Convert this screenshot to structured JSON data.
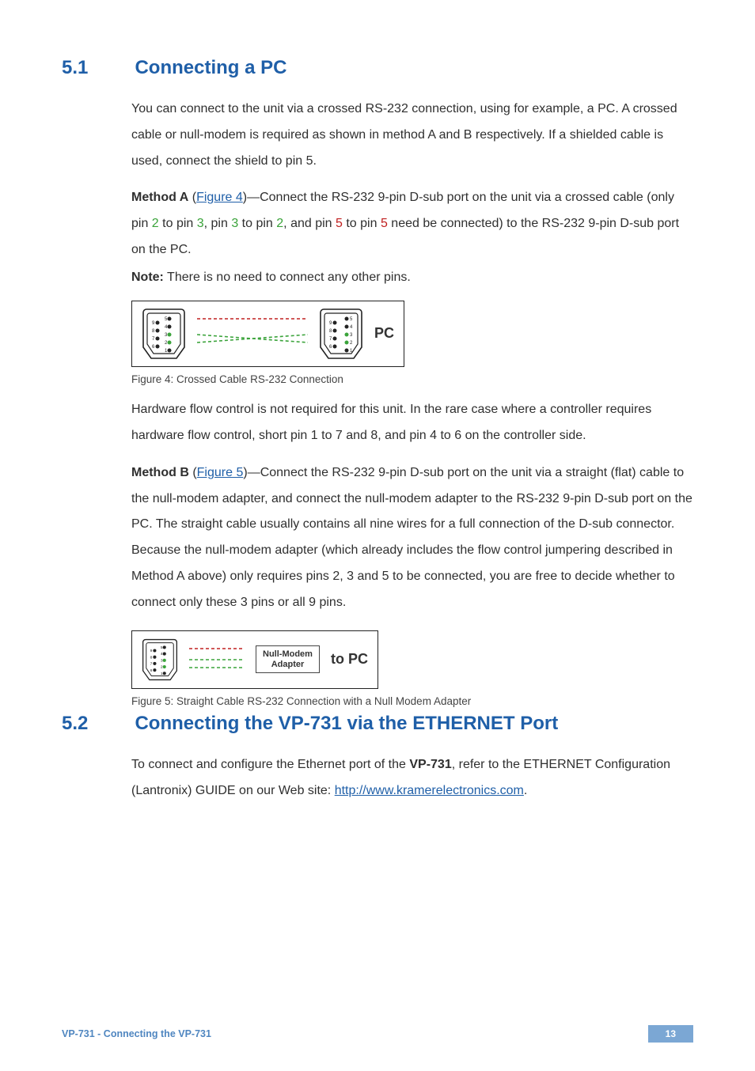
{
  "section1": {
    "num": "5.1",
    "title": "Connecting a PC",
    "p1": "You can connect to the unit via a crossed RS-232 connection, using for example, a PC. A crossed cable or null-modem is required as shown in method A and B respectively. If a shielded cable is used, connect the shield to pin 5.",
    "mA_lead": "Method A",
    "mA_link": "Figure 4",
    "mA_t1": " (",
    "mA_t2": ")—Connect the RS-232 9-pin D-sub port on the unit via a crossed cable (only pin ",
    "mA_pin2a": "2",
    "mA_to1": " to pin ",
    "mA_pin3a": "3",
    "mA_c1": ", pin ",
    "mA_pin3b": "3",
    "mA_to2": " to pin ",
    "mA_pin2b": "2",
    "mA_c2": ", and pin ",
    "mA_pin5a": "5",
    "mA_to3": " to pin ",
    "mA_pin5b": "5",
    "mA_tail": " need be connected) to the RS-232 9-pin D-sub port on the PC.",
    "note_lead": "Note:",
    "note_text": " There is no need to connect any other pins.",
    "fig4_pc": "PC",
    "fig4_caption": "Figure 4: Crossed Cable RS-232 Connection",
    "p3": "Hardware flow control is not required for this unit. In the rare case where a controller requires hardware flow control, short pin 1 to 7 and 8, and pin 4 to 6 on the controller side.",
    "mB_lead": "Method B",
    "mB_link": "Figure 5",
    "mB_t1": " (",
    "mB_t2": ")—Connect the RS-232 9-pin D-sub port on the unit via a straight (flat) cable to the null-modem adapter, and connect the null-modem adapter to the RS-232 9-pin D-sub port on the PC. The straight cable usually contains all nine wires for a full connection of the D-sub connector. Because the null-modem adapter (which already includes the flow control jumpering described in Method A above) only requires pins 2, 3 and 5 to be connected, you are free to decide whether to connect only these 3 pins or all 9 pins.",
    "fig5_nm_l1": "Null-Modem",
    "fig5_nm_l2": "Adapter",
    "fig5_pc": "to PC",
    "fig5_caption": "Figure 5: Straight Cable RS-232 Connection with a Null Modem Adapter"
  },
  "section2": {
    "num": "5.2",
    "title": "Connecting the VP-731 via the ETHERNET Port",
    "p1a": "To connect and configure the Ethernet port of the ",
    "p1b": "VP-731",
    "p1c": ", refer to the ETHERNET Configuration (Lantronix) GUIDE on our Web site: ",
    "link": "http://www.kramerelectronics.com",
    "p1d": "."
  },
  "footer": {
    "left": "VP-731 - Connecting the VP-731",
    "page": "13"
  }
}
